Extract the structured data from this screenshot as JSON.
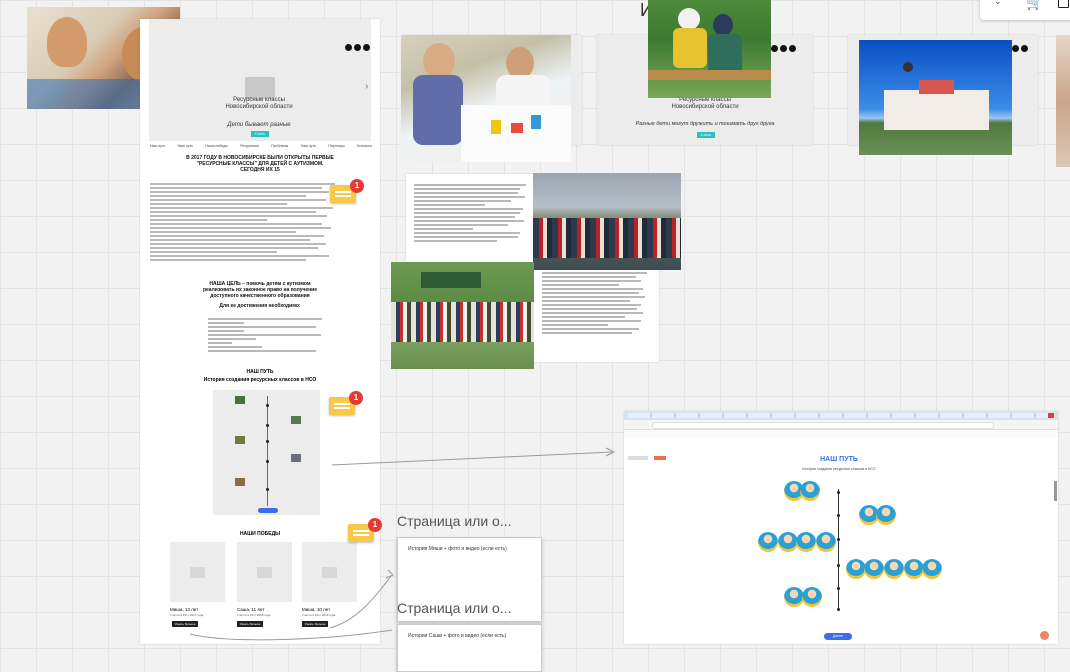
{
  "main_page": {
    "region": "Новосибирской области",
    "org_name": "Ресурсные классы",
    "tagline": "Дети бывают разные",
    "cta": "Стать",
    "nav": [
      "Наш путь",
      "Наш путь",
      "Наши победы",
      "Ресурсники",
      "Проблемы",
      "Наш путь",
      "Партнеры",
      "Контакты"
    ],
    "headline": "В 2017 ГОДУ В НОВОСИБИРСКЕ БЫЛИ ОТКРЫТЫ ПЕРВЫЕ \"РЕСУРСНЫЕ КЛАССЫ\" ДЛЯ ДЕТЕЙ С АУТИЗМОМ. СЕГОДНЯ ИХ 15",
    "goal_title": "НАША ЦЕЛЬ – помочь детям с аутизмом реализовать их законное право на получение доступного качественного образования",
    "goal_sub": "Для ее достижения необходимо:",
    "path_title": "НАШ ПУТЬ",
    "path_sub": "История создания ресурсных классов в НСО",
    "victories_title": "НАШИ ПОБЕДЫ",
    "kids": [
      {
        "name": "Миша, 13 лет",
        "note": "Учится в РК с 2017 года",
        "btn": "Узнать больше"
      },
      {
        "name": "Саша, 11 лет",
        "note": "Учится в РК с 2018 года",
        "btn": "Узнать больше"
      },
      {
        "name": "Миша, 10 лет",
        "note": "Учится в РК с 2019 года",
        "btn": "Узнать больше"
      }
    ]
  },
  "card2": {
    "org_name": "Ресурсные классы",
    "region": "Новосибирской области",
    "tagline": "Разные дети могут дружить и понимать друг друга",
    "cta": "Стать"
  },
  "comments": [
    {
      "count": "1"
    },
    {
      "count": "1"
    },
    {
      "count": "1"
    }
  ],
  "page_blocks": [
    {
      "title": "Страница или о...",
      "content": "История Миши + фото и видео (если есть)"
    },
    {
      "title": "Страница или о...",
      "content": "История Саши + фото и видео (если есть)"
    }
  ],
  "top_fragment": "И",
  "browser_shot": {
    "title": "НАШ ПУТЬ",
    "subtitle": "История создания ресурсных классов в НСО",
    "cta": "Далее"
  },
  "colors": {
    "accent": "#27c1c8",
    "comment": "#f7c948",
    "badge": "#e53935",
    "link": "#3b6ee8"
  }
}
